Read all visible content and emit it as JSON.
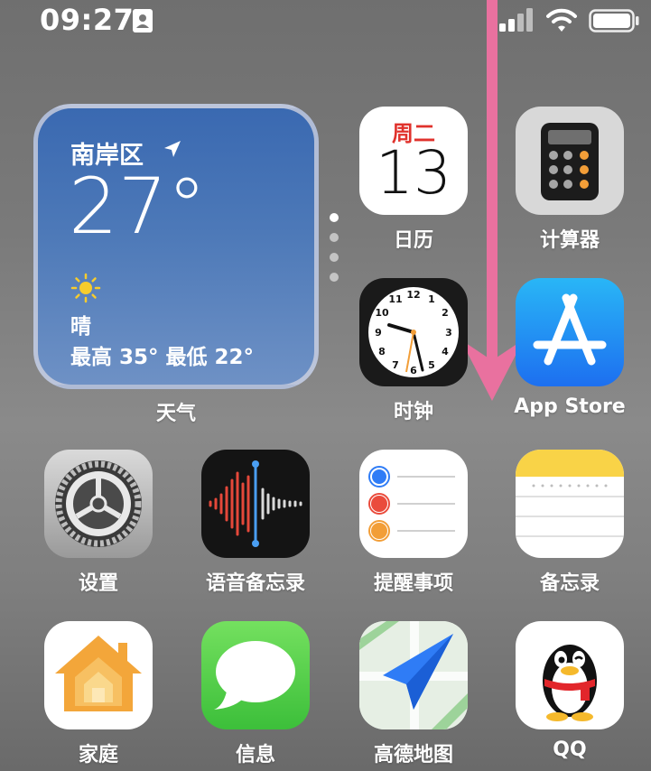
{
  "status_bar": {
    "time": "09:27"
  },
  "weather": {
    "location": "南岸区",
    "temperature": "27°",
    "condition": "晴",
    "range": "最高 35° 最低 22°",
    "label": "天气"
  },
  "calendar": {
    "weekday": "周二",
    "day": "13"
  },
  "apps": {
    "calendar": "日历",
    "calculator": "计算器",
    "clock": "时钟",
    "app_store": "App Store",
    "settings": "设置",
    "voice_memos": "语音备忘录",
    "reminders": "提醒事项",
    "notes": "备忘录",
    "home": "家庭",
    "messages": "信息",
    "amap": "高德地图",
    "qq": "QQ"
  },
  "colors": {
    "annotation_arrow": "#e9719f",
    "weather_bg": "#4a76b6",
    "calendar_red": "#e0322c",
    "calculator_orange": "#f29e38",
    "app_store_blue": "#1d8bf0",
    "messages_green": "#5fd14f",
    "home_orange": "#f3a63a",
    "notes_yellow": "#f9d347"
  }
}
